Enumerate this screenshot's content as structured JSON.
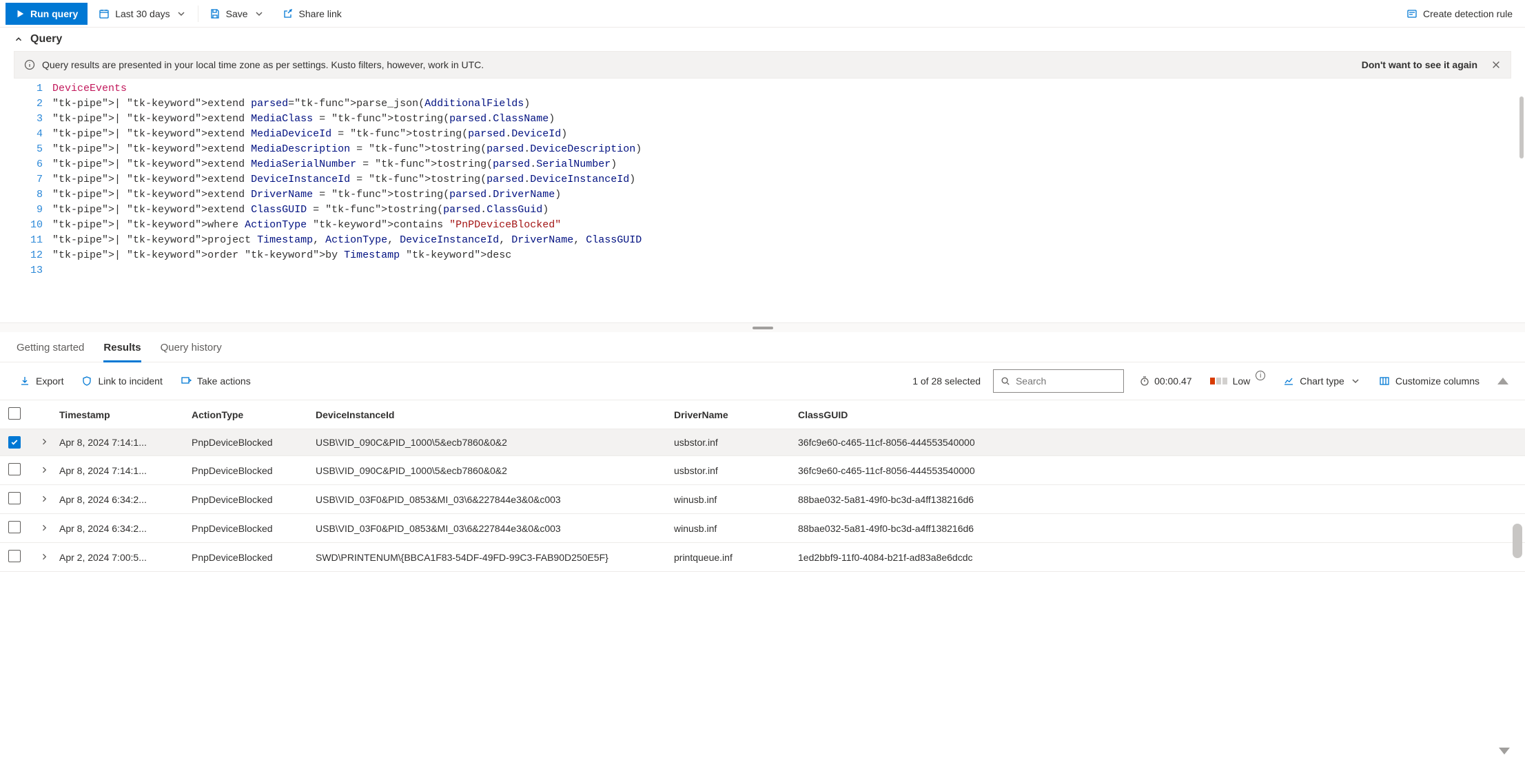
{
  "toolbar": {
    "run_label": "Run query",
    "timerange_label": "Last 30 days",
    "save_label": "Save",
    "share_label": "Share link",
    "create_rule_label": "Create detection rule"
  },
  "query_section": {
    "title": "Query"
  },
  "banner": {
    "text": "Query results are presented in your local time zone as per settings. Kusto filters, however, work in UTC.",
    "dismiss_hint": "Don't want to see it again"
  },
  "editor": {
    "lines": [
      "DeviceEvents",
      "| extend parsed=parse_json(AdditionalFields)",
      "| extend MediaClass = tostring(parsed.ClassName)",
      "| extend MediaDeviceId = tostring(parsed.DeviceId)",
      "| extend MediaDescription = tostring(parsed.DeviceDescription)",
      "| extend MediaSerialNumber = tostring(parsed.SerialNumber)",
      "| extend DeviceInstanceId = tostring(parsed.DeviceInstanceId)",
      "| extend DriverName = tostring(parsed.DriverName)",
      "| extend ClassGUID = tostring(parsed.ClassGuid)",
      "| where ActionType contains \"PnPDeviceBlocked\"",
      "| project Timestamp, ActionType, DeviceInstanceId, DriverName, ClassGUID",
      "| order by Timestamp desc",
      ""
    ]
  },
  "tabs": {
    "getting_started": "Getting started",
    "results": "Results",
    "history": "Query history"
  },
  "results_toolbar": {
    "export": "Export",
    "link_incident": "Link to incident",
    "take_actions": "Take actions",
    "selected_text": "1 of 28 selected",
    "search_placeholder": "Search",
    "elapsed": "00:00.47",
    "severity": "Low",
    "chart_type": "Chart type",
    "customize": "Customize columns"
  },
  "columns": {
    "timestamp": "Timestamp",
    "action": "ActionType",
    "instance": "DeviceInstanceId",
    "driver": "DriverName",
    "guid": "ClassGUID"
  },
  "rows": [
    {
      "selected": true,
      "ts": "Apr 8, 2024 7:14:1...",
      "action": "PnpDeviceBlocked",
      "inst": "USB\\VID_090C&PID_1000\\5&ecb7860&0&2",
      "driver": "usbstor.inf",
      "guid": "36fc9e60-c465-11cf-8056-444553540000"
    },
    {
      "selected": false,
      "ts": "Apr 8, 2024 7:14:1...",
      "action": "PnpDeviceBlocked",
      "inst": "USB\\VID_090C&PID_1000\\5&ecb7860&0&2",
      "driver": "usbstor.inf",
      "guid": "36fc9e60-c465-11cf-8056-444553540000"
    },
    {
      "selected": false,
      "ts": "Apr 8, 2024 6:34:2...",
      "action": "PnpDeviceBlocked",
      "inst": "USB\\VID_03F0&PID_0853&MI_03\\6&227844e3&0&c003",
      "driver": "winusb.inf",
      "guid": "88bae032-5a81-49f0-bc3d-a4ff138216d6"
    },
    {
      "selected": false,
      "ts": "Apr 8, 2024 6:34:2...",
      "action": "PnpDeviceBlocked",
      "inst": "USB\\VID_03F0&PID_0853&MI_03\\6&227844e3&0&c003",
      "driver": "winusb.inf",
      "guid": "88bae032-5a81-49f0-bc3d-a4ff138216d6"
    },
    {
      "selected": false,
      "ts": "Apr 2, 2024 7:00:5...",
      "action": "PnpDeviceBlocked",
      "inst": "SWD\\PRINTENUM\\{BBCA1F83-54DF-49FD-99C3-FAB90D250E5F}",
      "driver": "printqueue.inf",
      "guid": "1ed2bbf9-11f0-4084-b21f-ad83a8e6dcdc"
    }
  ]
}
